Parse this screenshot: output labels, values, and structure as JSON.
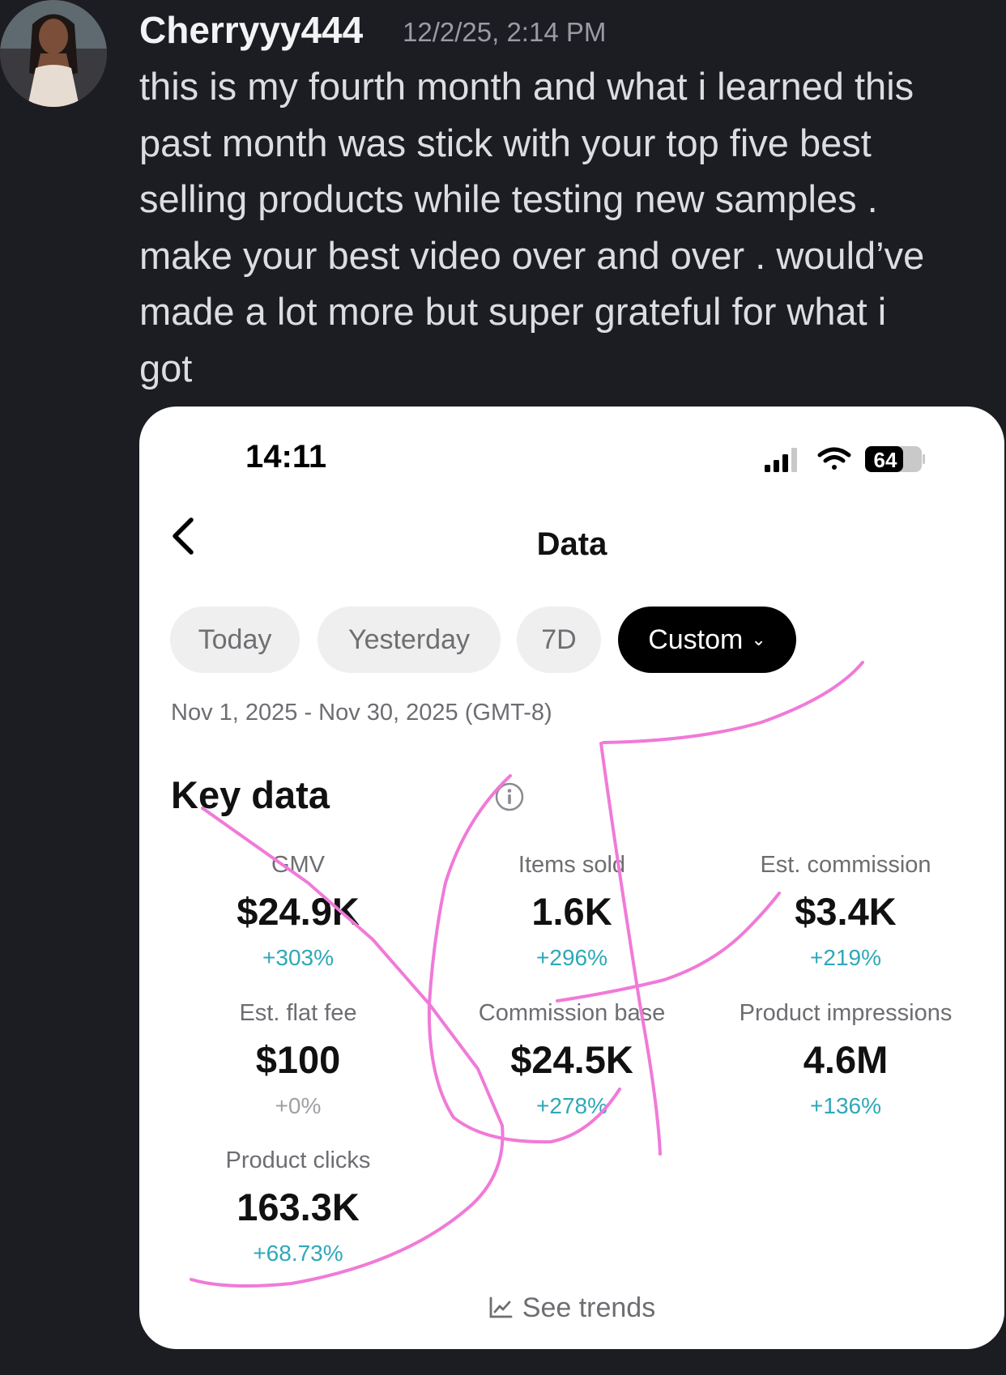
{
  "message": {
    "author": "Cherryyy444",
    "timestamp": "12/2/25, 2:14 PM",
    "text": "this is my fourth month and what i learned this\npast month was stick with your top five best\nselling products while testing new samples .\nmake your best video over and over . would’ve\nmade a lot more but super grateful for what i\ngot"
  },
  "phone": {
    "status_time": "14:11",
    "battery": "64",
    "page_title": "Data",
    "back_icon": "chevron-left-icon",
    "tabs": [
      {
        "label": "Today",
        "active": false
      },
      {
        "label": "Yesterday",
        "active": false
      },
      {
        "label": "7D",
        "active": false
      },
      {
        "label": "Custom",
        "active": true
      }
    ],
    "date_range": "Nov 1, 2025 - Nov 30, 2025 (GMT-8)",
    "section_title": "Key data",
    "metrics": [
      {
        "label": "GMV",
        "value": "$24.9K",
        "change": "+303%"
      },
      {
        "label": "Items sold",
        "value": "1.6K",
        "change": "+296%"
      },
      {
        "label": "Est. commission",
        "value": "$3.4K",
        "change": "+219%"
      },
      {
        "label": "Est. flat fee",
        "value": "$100",
        "change": "+0%"
      },
      {
        "label": "Commission base",
        "value": "$24.5K",
        "change": "+278%"
      },
      {
        "label": "Product impressions",
        "value": "4.6M",
        "change": "+136%"
      },
      {
        "label": "Product clicks",
        "value": "163.3K",
        "change": "+68.73%"
      }
    ],
    "see_trends": "See trends"
  },
  "colors": {
    "background": "#1c1d22",
    "positive_change": "#2fa8b8",
    "doodle": "#f07ad8"
  }
}
